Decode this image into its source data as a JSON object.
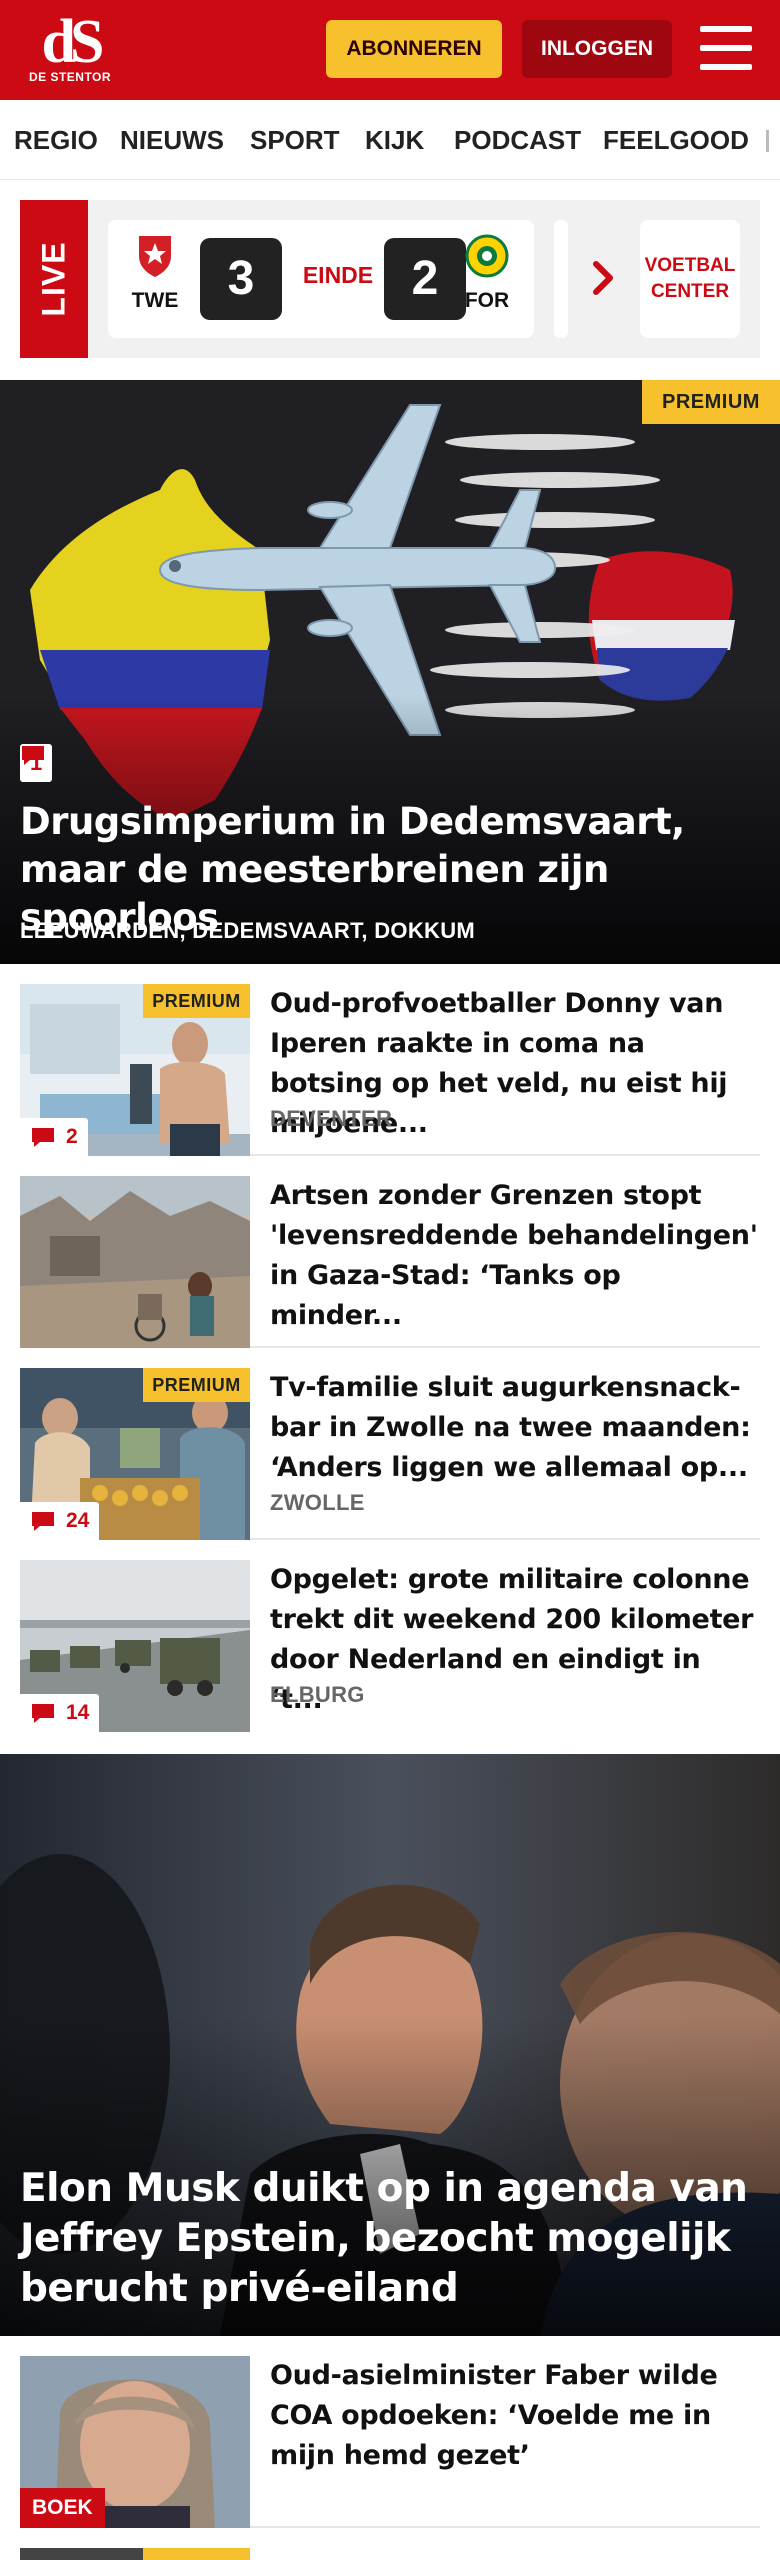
{
  "header": {
    "logo_mark": "dS",
    "logo_sub": "DE STENTOR",
    "subscribe_label": "ABONNEREN",
    "login_label": "INLOGGEN",
    "menu_icon": "hamburger-menu-icon",
    "colors": {
      "brand": "#cc0a14",
      "subscribe": "#f6c12c",
      "login": "#9e0710"
    }
  },
  "nav": {
    "items": [
      "REGIO",
      "NIEUWS",
      "SPORT",
      "KIJK",
      "PODCAST",
      "FEELGOOD"
    ]
  },
  "live": {
    "label": "LIVE",
    "match": {
      "home_code": "TWE",
      "home_score": "3",
      "status": "EINDE",
      "away_score": "2",
      "away_code": "FOR"
    },
    "center_label_1": "VOETBAL",
    "center_label_2": "CENTER",
    "arrow_icon": "chevron-right-icon"
  },
  "hero": {
    "badge": "PREMIUM",
    "comments": "1",
    "title": "Drugsimperium in Dedemsvaart, maar de meesterbreinen zijn spoorloos",
    "places": "LEEUWARDEN, DEDEMSVAART, DOKKUM"
  },
  "articles": [
    {
      "premium": "PREMIUM",
      "comments": "2",
      "title": "Oud-profvoetballer Donny van Iperen raakte in coma na botsing op het veld, nu eist hij miljoene...",
      "place": "DEVENTER"
    },
    {
      "title": "Artsen zonder Grenzen stopt 'levensreddende behandelingen' in Gaza-Stad: ‘Tanks op minder...",
      "place": ""
    },
    {
      "premium": "PREMIUM",
      "comments": "24",
      "title": "Tv-familie sluit augurkensnack­bar in Zwolle na twee maanden: ‘Anders liggen we allemaal op...",
      "place": "ZWOLLE"
    },
    {
      "comments": "14",
      "title": "Opgelet: grote militaire colonne trekt dit weekend 200 kilometer door Nederland en eindigt in ‘t...",
      "place": "ELBURG"
    }
  ],
  "hero2": {
    "title": "Elon Musk duikt op in agenda van Jeffrey Epstein, bezocht mogelijk berucht privé-eiland"
  },
  "article5": {
    "tag": "BOEK",
    "title": "Oud-asielminister Faber wilde COA opdoeken: ‘Voelde me in mijn hemd gezet’"
  }
}
